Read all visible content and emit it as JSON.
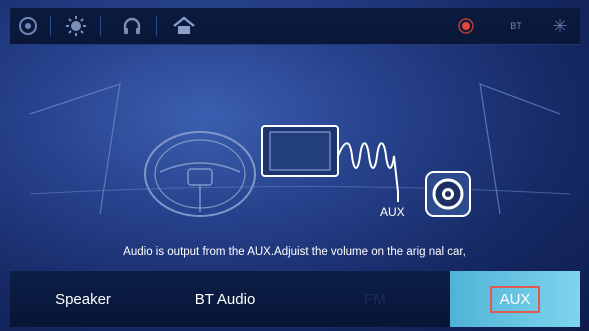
{
  "topbar": {
    "icons": [
      "camera-icon",
      "brightness-icon",
      "headphones-icon",
      "home-icon",
      "record-icon",
      "signal-icon",
      "snowflake-icon"
    ],
    "signal_text": "BT"
  },
  "scene": {
    "aux_label": "AUX"
  },
  "message": "Audio is output from the AUX.Adjuist the volume on the arig nal car,",
  "tabs": {
    "speaker": "Speaker",
    "bt_audio": "BT Audio",
    "fm": "FM",
    "aux": "AUX"
  },
  "colors": {
    "accent_tab": "#5fc1e0",
    "highlight_border": "#e05b4f",
    "record_red": "#e0463a"
  }
}
